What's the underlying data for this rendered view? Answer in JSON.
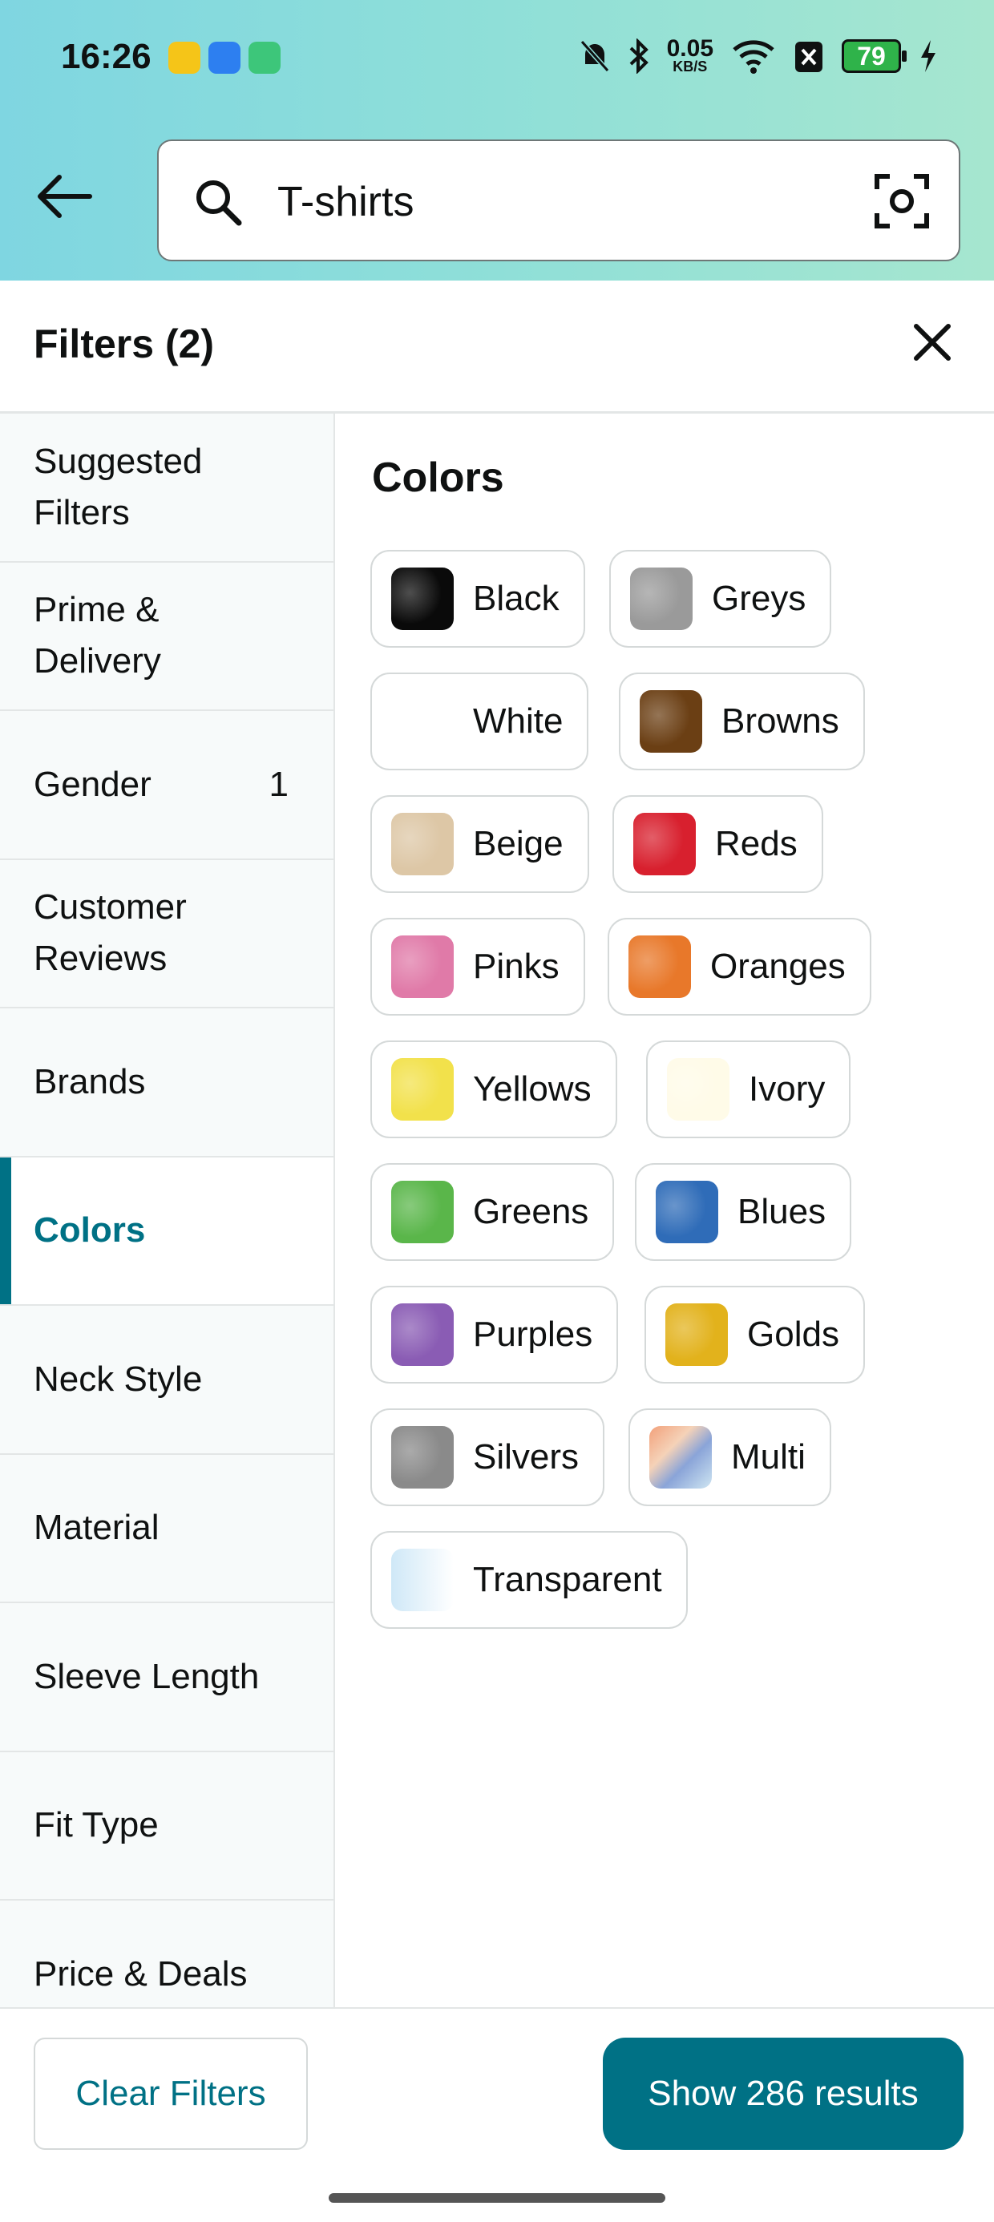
{
  "status_bar": {
    "time": "16:26",
    "net_speed_value": "0.05",
    "net_speed_unit": "KB/S",
    "battery": "79"
  },
  "search": {
    "query": "T-shirts"
  },
  "filters": {
    "title": "Filters (2)"
  },
  "sidebar": {
    "items": [
      {
        "label": "Suggested Filters",
        "count": ""
      },
      {
        "label": "Prime & Delivery",
        "count": ""
      },
      {
        "label": "Gender",
        "count": "1"
      },
      {
        "label": "Customer Reviews",
        "count": ""
      },
      {
        "label": "Brands",
        "count": ""
      },
      {
        "label": "Colors",
        "count": ""
      },
      {
        "label": "Neck Style",
        "count": ""
      },
      {
        "label": "Material",
        "count": ""
      },
      {
        "label": "Sleeve Length",
        "count": ""
      },
      {
        "label": "Fit Type",
        "count": ""
      },
      {
        "label": "Price & Deals",
        "count": ""
      }
    ],
    "active": "Colors"
  },
  "colors_panel": {
    "title": "Colors",
    "swatches": [
      {
        "label": "Black",
        "color": "#0a0a0a"
      },
      {
        "label": "Greys",
        "color": "#9a9a9a"
      },
      {
        "label": "White",
        "color": "#ffffff"
      },
      {
        "label": "Browns",
        "color": "#6b3f14"
      },
      {
        "label": "Beige",
        "color": "#ddc7a6"
      },
      {
        "label": "Reds",
        "color": "#d8202e"
      },
      {
        "label": "Pinks",
        "color": "#e07aa8"
      },
      {
        "label": "Oranges",
        "color": "#e8782a"
      },
      {
        "label": "Yellows",
        "color": "#f2e14b"
      },
      {
        "label": "Ivory",
        "color": "#fffbe8"
      },
      {
        "label": "Greens",
        "color": "#5ab64a"
      },
      {
        "label": "Blues",
        "color": "#2f6cb8"
      },
      {
        "label": "Purples",
        "color": "#8a5cb4"
      },
      {
        "label": "Golds",
        "color": "#e2b21c"
      },
      {
        "label": "Silvers",
        "color": "#8a8a8a"
      },
      {
        "label": "Multi",
        "color": "#f0b89a"
      },
      {
        "label": "Transparent",
        "color": "#d8eef9"
      }
    ]
  },
  "bottom_bar": {
    "clear_label": "Clear Filters",
    "show_label": "Show 286 results"
  }
}
